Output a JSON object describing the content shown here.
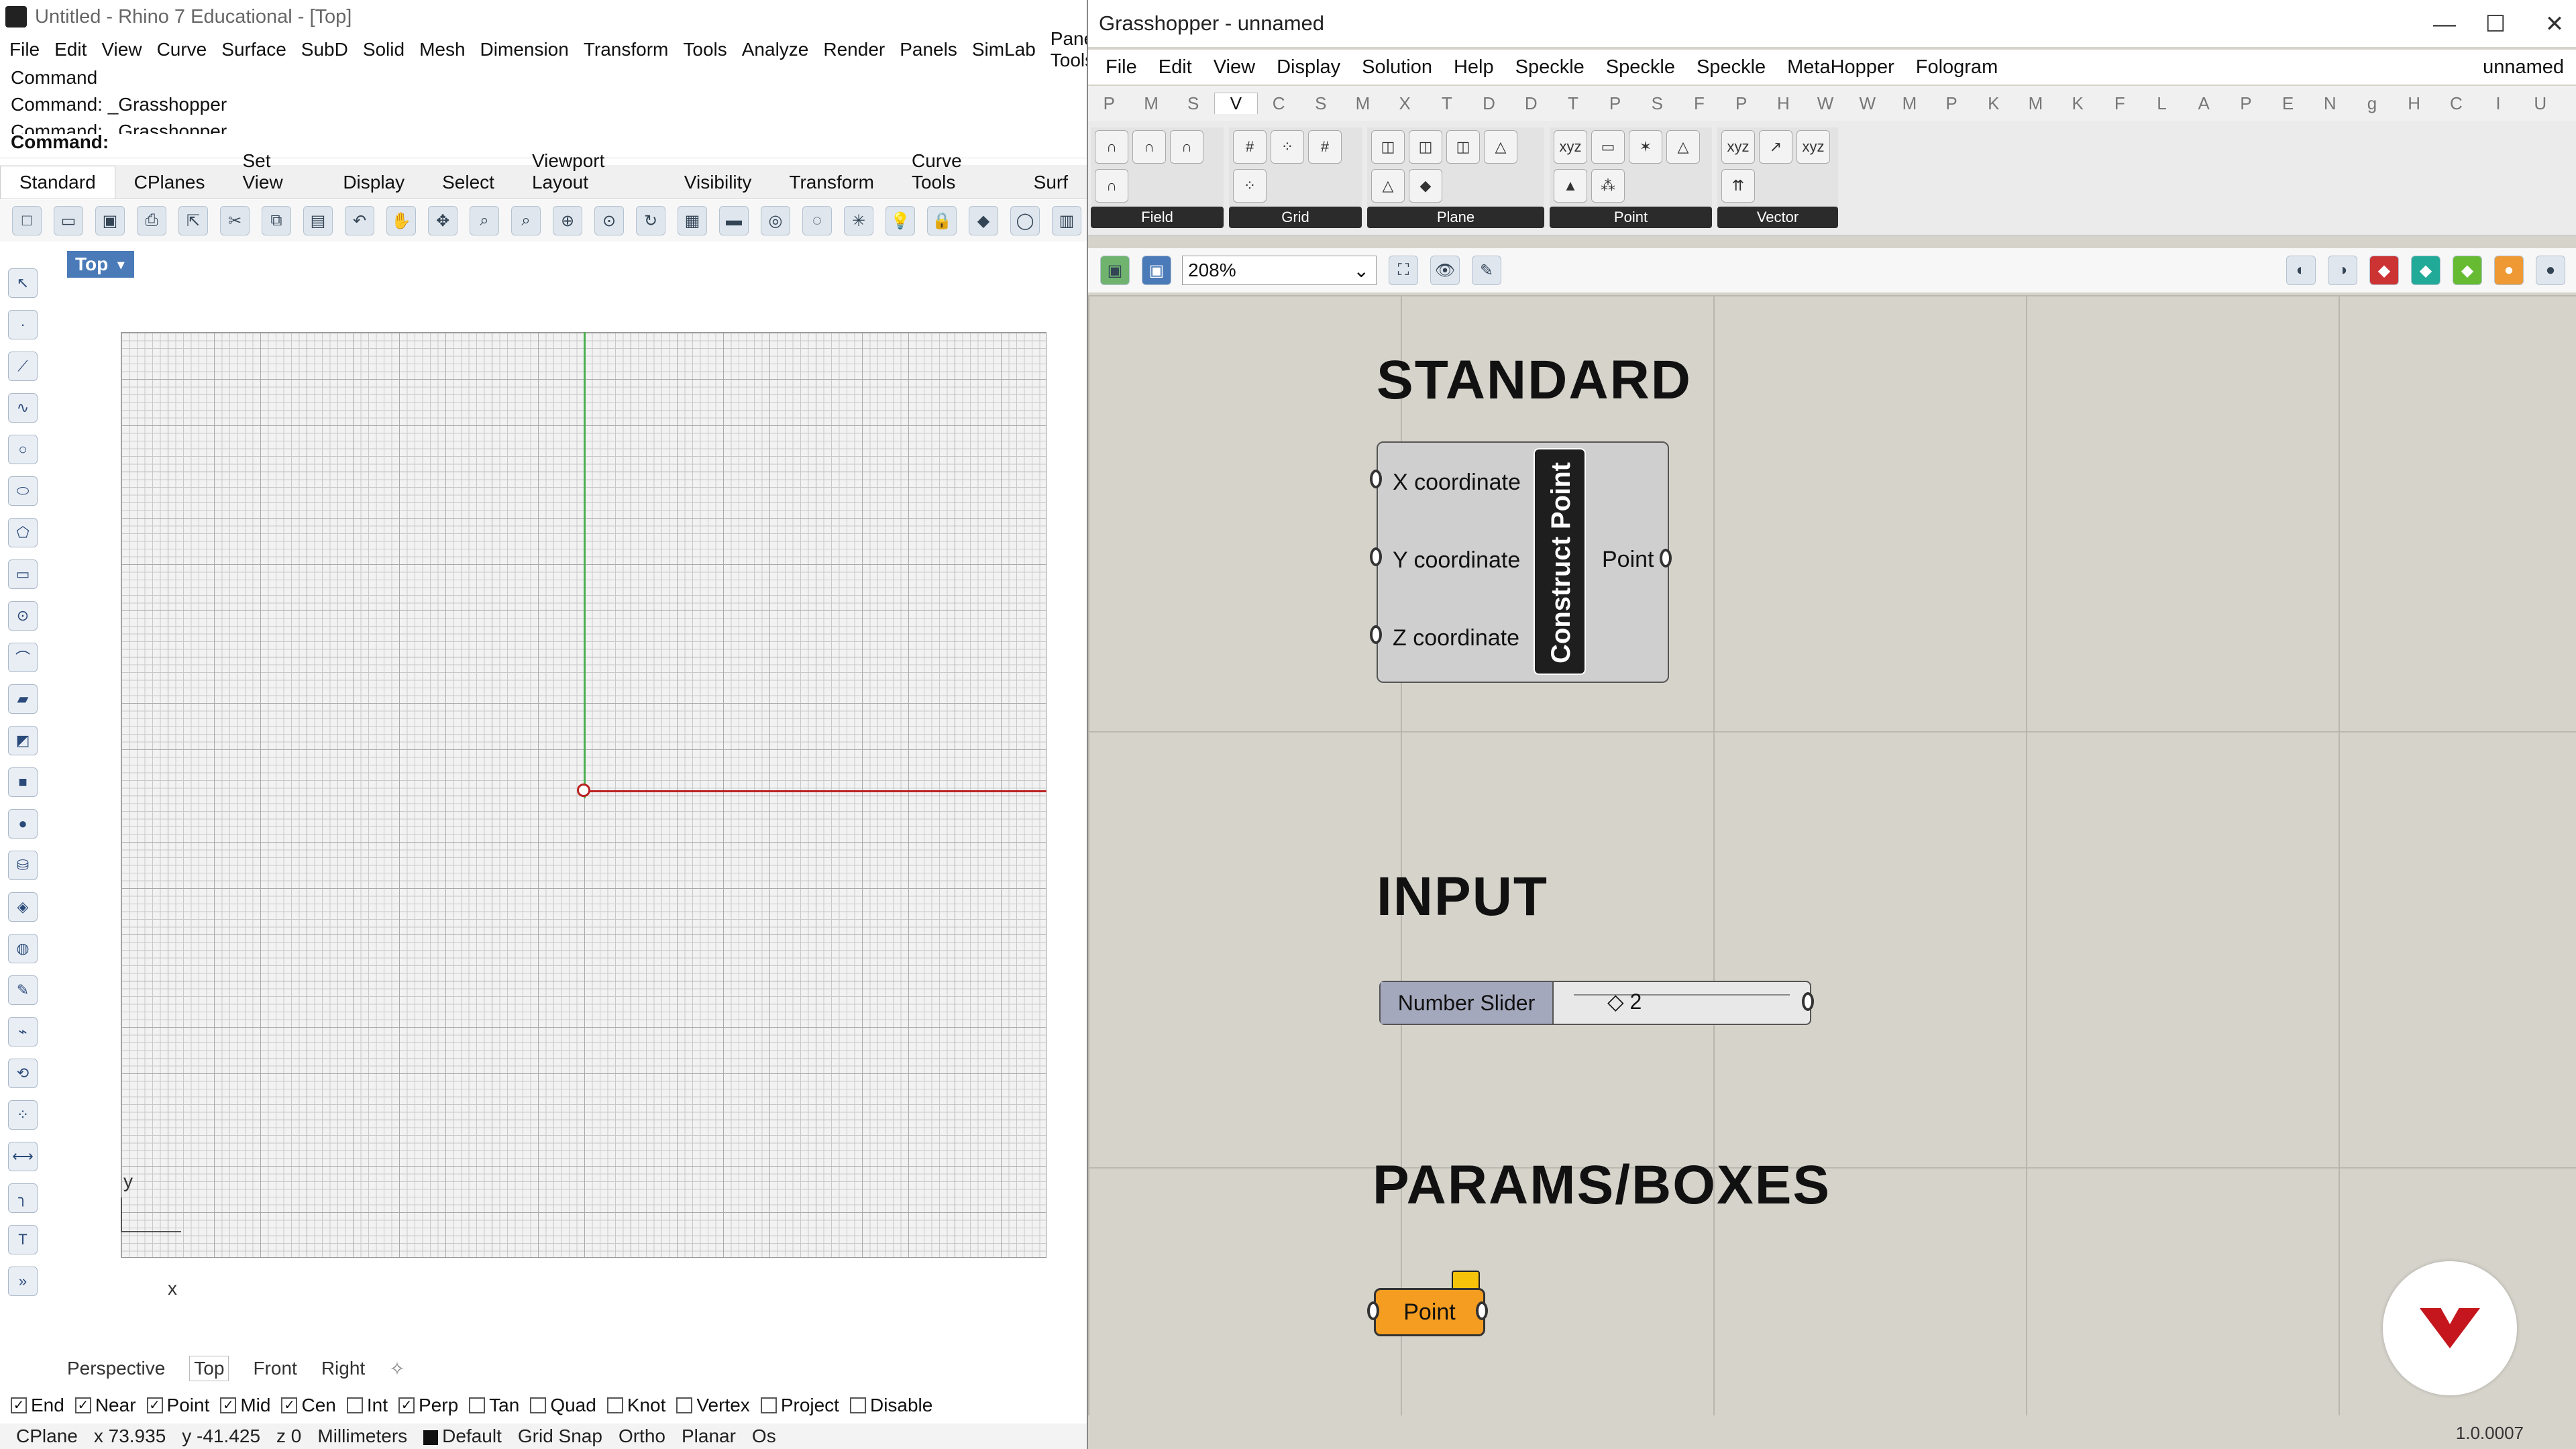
{
  "rhino": {
    "title": "Untitled - Rhino 7 Educational - [Top]",
    "menus": [
      "File",
      "Edit",
      "View",
      "Curve",
      "Surface",
      "SubD",
      "Solid",
      "Mesh",
      "Dimension",
      "Transform",
      "Tools",
      "Analyze",
      "Render",
      "Panels",
      "SimLab",
      "Paneling Tools"
    ],
    "command_history": [
      "Command",
      "Command: _Grasshopper",
      "Command: _Grasshopper"
    ],
    "command_prompt": "Command:",
    "toolbar_tabs": [
      "Standard",
      "CPlanes",
      "Set View",
      "Display",
      "Select",
      "Viewport Layout",
      "Visibility",
      "Transform",
      "Curve Tools",
      "Surf"
    ],
    "viewport_label": "Top",
    "axis_labels": {
      "x": "x",
      "y": "y"
    },
    "view_tabs": [
      "Perspective",
      "Top",
      "Front",
      "Right"
    ],
    "osnaps": [
      {
        "label": "End",
        "checked": true
      },
      {
        "label": "Near",
        "checked": true
      },
      {
        "label": "Point",
        "checked": true
      },
      {
        "label": "Mid",
        "checked": true
      },
      {
        "label": "Cen",
        "checked": true
      },
      {
        "label": "Int",
        "checked": false
      },
      {
        "label": "Perp",
        "checked": true
      },
      {
        "label": "Tan",
        "checked": false
      },
      {
        "label": "Quad",
        "checked": false
      },
      {
        "label": "Knot",
        "checked": false
      },
      {
        "label": "Vertex",
        "checked": false
      },
      {
        "label": "Project",
        "checked": false
      },
      {
        "label": "Disable",
        "checked": false
      }
    ],
    "status": {
      "cplane": "CPlane",
      "x": "x 73.935",
      "y": "y -41.425",
      "z": "z 0",
      "units": "Millimeters",
      "layer": "Default",
      "grid_snap": "Grid Snap",
      "ortho": "Ortho",
      "planar": "Planar",
      "osnap": "Os"
    }
  },
  "gh": {
    "title": "Grasshopper - unnamed",
    "doc_name": "unnamed",
    "menus": [
      "File",
      "Edit",
      "View",
      "Display",
      "Solution",
      "Help",
      "Speckle",
      "Speckle",
      "Speckle",
      "MetaHopper",
      "Fologram"
    ],
    "tabs": [
      "P",
      "M",
      "S",
      "V",
      "C",
      "S",
      "M",
      "X",
      "T",
      "D",
      "D",
      "T",
      "P",
      "S",
      "F",
      "P",
      "H",
      "W",
      "W",
      "M",
      "P",
      "K",
      "M",
      "K",
      "F",
      "L",
      "A",
      "P",
      "E",
      "N",
      "g",
      "H",
      "C",
      "I",
      "U"
    ],
    "active_tab": "V",
    "panels": [
      "Field",
      "Grid",
      "Plane",
      "Point",
      "Vector"
    ],
    "zoom": "208%",
    "groups": {
      "standard": "STANDARD",
      "input": "INPUT",
      "params": "PARAMS/BOXES"
    },
    "construct_point": {
      "name": "Construct Point",
      "inputs": [
        "X coordinate",
        "Y coordinate",
        "Z coordinate"
      ],
      "output": "Point"
    },
    "slider": {
      "name": "Number Slider",
      "value": "2"
    },
    "point_param": "Point",
    "version": "1.0.0007"
  }
}
